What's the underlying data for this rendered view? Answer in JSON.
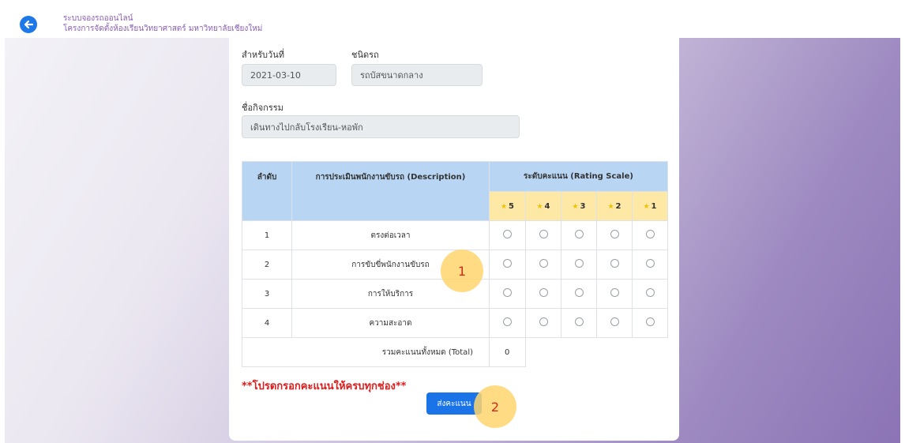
{
  "header": {
    "title_line1": "ระบบจองรถออนไลน์",
    "title_line2": "โครงการจัดตั้งห้องเรียนวิทยาศาสตร์ มหาวิทยาลัยเชียงใหม่"
  },
  "form": {
    "date_label": "สำหรับวันที่",
    "date_value": "2021-03-10",
    "vehicle_label": "ชนิดรถ",
    "vehicle_value": "รถบัสขนาดกลาง",
    "activity_label": "ชื่อกิจกรรม",
    "activity_value": "เดินทางไปกลับโรงเรียน-หอพัก"
  },
  "table": {
    "col_no": "ลำดับ",
    "col_desc": "การประเมินพนักงานขับรถ (Description)",
    "col_rating": "ระดับคะแนน (Rating Scale)",
    "scale": [
      "5",
      "4",
      "3",
      "2",
      "1"
    ],
    "rows": [
      {
        "no": "1",
        "desc": "ตรงต่อเวลา"
      },
      {
        "no": "2",
        "desc": "การขับขี่พนักงานขับรถ"
      },
      {
        "no": "3",
        "desc": "การให้บริการ"
      },
      {
        "no": "4",
        "desc": "ความสะอาด"
      }
    ],
    "total_label": "รวมคะแนนทั้งหมด (Total)",
    "total_value": "0"
  },
  "warning": "**โปรดกรอกคะแนนให้ครบทุกช่อง**",
  "submit_label": "ส่งคะแนน",
  "markers": [
    "1",
    "2"
  ],
  "colors": {
    "accent": "#1a74e8",
    "header_cell": "#b8d6f4",
    "star_cell": "#fde8a6",
    "warning": "#e01b1b"
  }
}
